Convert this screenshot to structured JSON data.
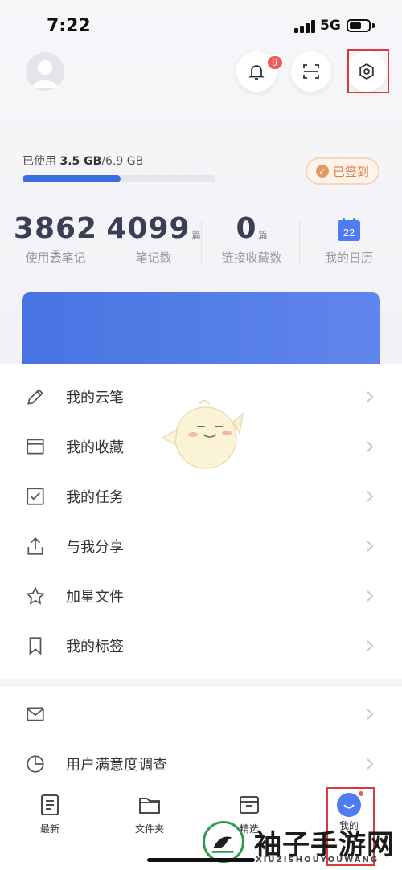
{
  "status_bar": {
    "time": "7:22",
    "network": "5G"
  },
  "header": {
    "notification_count": "9"
  },
  "storage": {
    "prefix": "已使用 ",
    "used": "3.5 GB",
    "total": "/6.9 GB",
    "used_fraction": 0.51
  },
  "signin": {
    "label": "已签到"
  },
  "stats": [
    {
      "value": "3862",
      "unit": "天",
      "label": "使用云笔记"
    },
    {
      "value": "4099",
      "unit": "篇",
      "label": "笔记数"
    },
    {
      "value": "0",
      "unit": "篇",
      "label": "链接收藏数"
    },
    {
      "value": "22",
      "unit": "",
      "label": "我的日历"
    }
  ],
  "menu": {
    "items": [
      {
        "label": "我的云笔",
        "icon": "pencil-icon"
      },
      {
        "label": "我的收藏",
        "icon": "archive-box-icon"
      },
      {
        "label": "我的任务",
        "icon": "checkbox-icon"
      },
      {
        "label": "与我分享",
        "icon": "share-upload-icon"
      },
      {
        "label": "加星文件",
        "icon": "star-icon"
      },
      {
        "label": "我的标签",
        "icon": "bookmark-icon"
      }
    ],
    "extra_items": [
      {
        "label": "",
        "icon": "envelope-icon"
      },
      {
        "label": "用户满意度调查",
        "icon": "pie-chart-icon"
      }
    ]
  },
  "tabbar": {
    "tabs": [
      {
        "label": "最新",
        "icon": "document-icon"
      },
      {
        "label": "文件夹",
        "icon": "folder-icon"
      },
      {
        "label": "精选",
        "icon": "featured-box-icon"
      },
      {
        "label": "我的",
        "icon": "profile-smile-icon"
      }
    ]
  },
  "watermark": {
    "text": "袖子手游网",
    "subtext": "XIUZISHOUYOUWANG"
  },
  "colors": {
    "accent": "#3b6fe0",
    "badge": "#f05a5a",
    "signin": "#e07f43",
    "highlight": "#d63c3c"
  }
}
